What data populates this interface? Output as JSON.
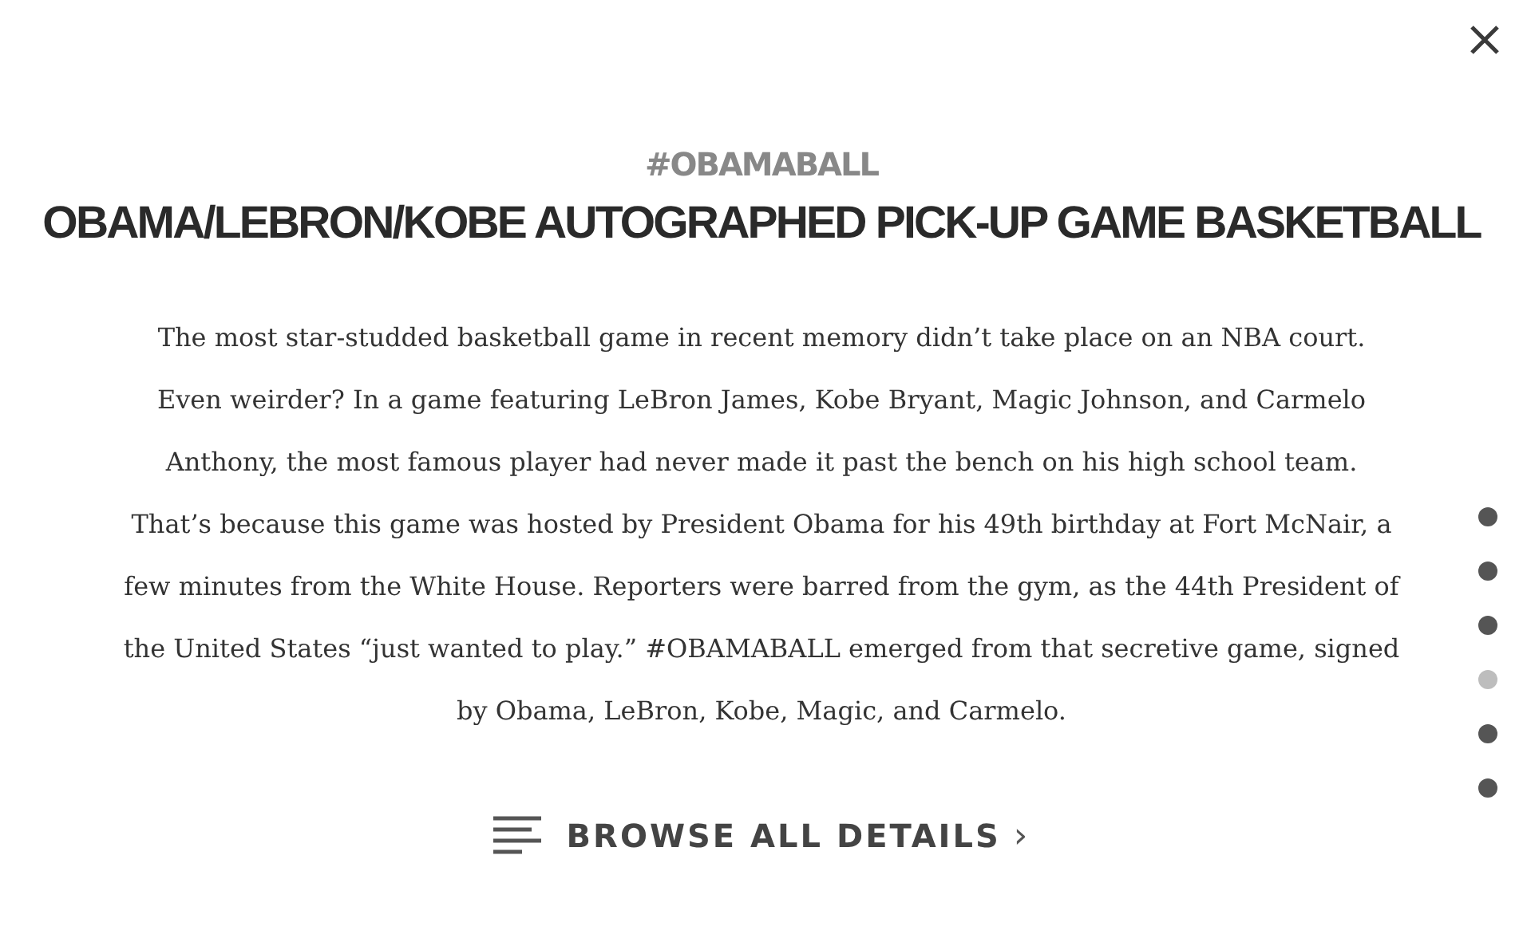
{
  "hashtag": "#OBAMABALL",
  "title": "OBAMA/LEBRON/KOBE AUTOGRAPHED PICK-UP GAME BASKETBALL",
  "description": "The most star-studded basketball game in recent memory didn’t take place on an NBA court. Even weirder? In a game featuring LeBron James, Kobe Bryant, Magic Johnson, and Carmelo Anthony, the most famous player had never made it past the bench on his high school team. That’s because this game was hosted by President Obama for his 49th birthday at Fort McNair, a few minutes from the White House. Reporters were barred from the gym, as the 44th President of the United States “just wanted to play.” #OBAMABALL emerged from that secretive game, signed by Obama, LeBron, Kobe, Magic, and Carmelo.",
  "browse_link": {
    "label": "BROWSE ALL DETAILS",
    "chevron": "›"
  },
  "pager": [
    {
      "selected": false
    },
    {
      "selected": false
    },
    {
      "selected": false
    },
    {
      "selected": true
    },
    {
      "selected": false
    },
    {
      "selected": false
    }
  ]
}
